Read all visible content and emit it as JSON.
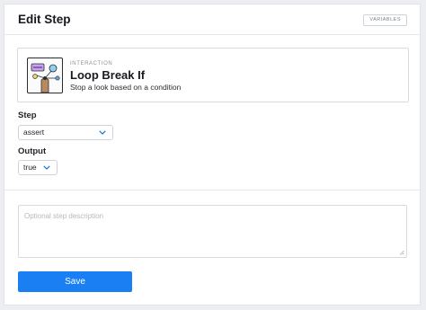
{
  "header": {
    "title": "Edit Step",
    "variables_label": "VARIABLES"
  },
  "step_card": {
    "category": "INTERACTION",
    "name": "Loop Break If",
    "description": "Stop a look based on a condition",
    "icon": "loop-break-illustration"
  },
  "form": {
    "step_label": "Step",
    "step_value": "assert",
    "output_label": "Output",
    "output_value": "true",
    "description_placeholder": "Optional step description"
  },
  "actions": {
    "save_label": "Save"
  },
  "colors": {
    "primary": "#1a7ff2",
    "chevron": "#1a6fd6"
  }
}
